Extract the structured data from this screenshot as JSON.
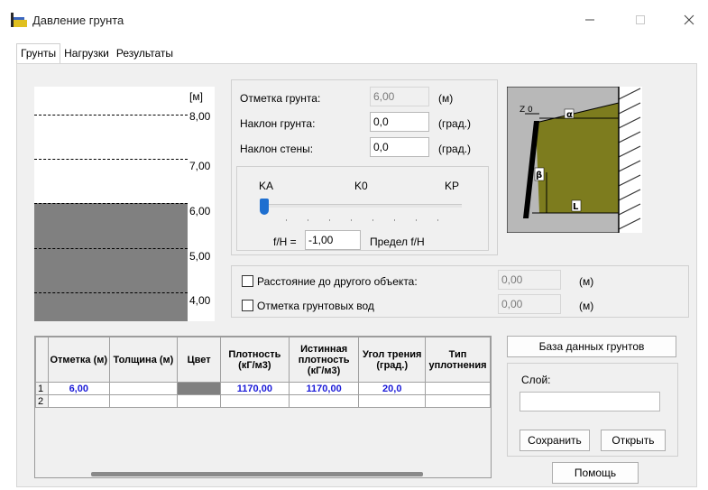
{
  "window": {
    "title": "Давление грунта"
  },
  "tabs": [
    {
      "label": "Грунты",
      "active": true
    },
    {
      "label": "Нагрузки",
      "active": false
    },
    {
      "label": "Результаты",
      "active": false
    }
  ],
  "soil_chart": {
    "unit": "[м]",
    "scale_labels": [
      "8,00",
      "7,00",
      "6,00",
      "5,00",
      "4,00"
    ],
    "soil_level": "6,00",
    "fill_color": "#808080"
  },
  "params": {
    "ground_mark": {
      "label": "Отметка грунта:",
      "value": "6,00",
      "unit": "(м)"
    },
    "ground_slope": {
      "label": "Наклон грунта:",
      "value": "0,0",
      "unit": "(град.)"
    },
    "wall_slope": {
      "label": "Наклон стены:",
      "value": "0,0",
      "unit": "(град.)"
    }
  },
  "coefficient": {
    "labels": [
      "KA",
      "K0",
      "KP"
    ],
    "slider_position": 0,
    "fh_label": "f/H =",
    "fh_value": "-1,00",
    "limit_label": "Предел f/H"
  },
  "diagram": {
    "labels": [
      "Z 0",
      "α",
      "β",
      "L"
    ],
    "soil_color": "#7d7c1e"
  },
  "options": {
    "distance": {
      "label": "Расстояние до другого объекта:",
      "value": "0,00",
      "unit": "(м)",
      "checked": false
    },
    "groundwater": {
      "label": "Отметка грунтовых вод",
      "value": "0,00",
      "unit": "(м)",
      "checked": false
    }
  },
  "soil_table": {
    "columns": [
      "Отметка (м)",
      "Толщина (м)",
      "Цвет",
      "Плотность (кГ/м3)",
      "Истинная плотность (кГ/м3)",
      "Угол трения (град.)",
      "Тип уплотнения"
    ],
    "rows": [
      {
        "num": "1",
        "mark": "6,00",
        "thickness": "",
        "color": "#808080",
        "density": "1170,00",
        "true_density": "1170,00",
        "friction": "20,0",
        "compaction": ""
      },
      {
        "num": "2",
        "mark": "",
        "thickness": "",
        "color": "",
        "density": "",
        "true_density": "",
        "friction": "",
        "compaction": ""
      }
    ]
  },
  "side": {
    "db_button": "База данных грунтов",
    "layer_label": "Слой:",
    "layer_value": "",
    "save_button": "Сохранить",
    "open_button": "Открыть",
    "help_button": "Помощь"
  }
}
